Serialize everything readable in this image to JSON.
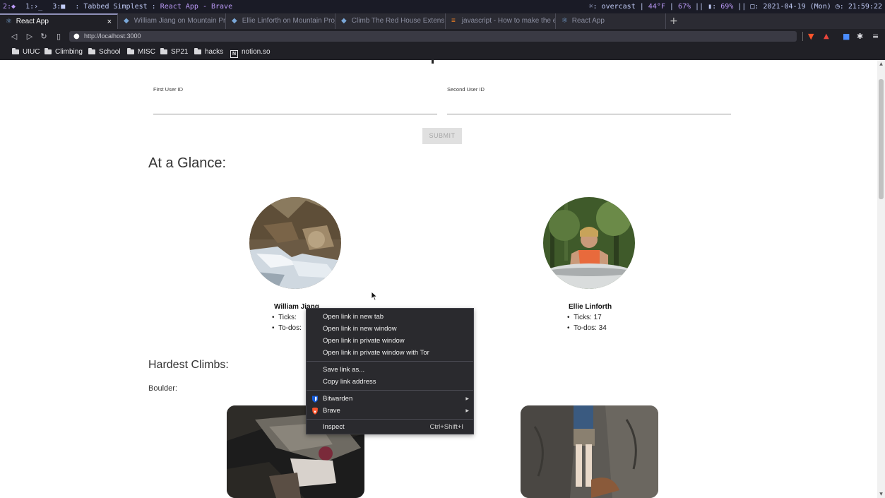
{
  "wm": {
    "ws1": "2:◆",
    "ws2": "1:›_",
    "ws3": "3:■",
    "title_prefix": ": Tabbed Simplest : ",
    "title_app": "React App - Brave",
    "weather": "☼: overcast",
    "temp": "44°F",
    "brightness": "67%",
    "battery_label": "▮:",
    "battery": "69%",
    "date": "□: 2021-04-19 (Mon)",
    "time": "◷: 21:59:22"
  },
  "tabs": [
    {
      "label": "React App",
      "active": true,
      "close": "×"
    },
    {
      "label": "William Jiang on Mountain Proje"
    },
    {
      "label": "Ellie Linforth on Mountain Proje"
    },
    {
      "label": "Climb The Red House Extension"
    },
    {
      "label": "javascript - How to make the en"
    },
    {
      "label": "React App"
    }
  ],
  "newtab": "+",
  "nav": {
    "back": "◁",
    "forward": "▷",
    "reload": "↻",
    "bookmark": "▯",
    "url": "http://localhost:3000"
  },
  "bookmarks": [
    {
      "label": "UIUC"
    },
    {
      "label": "Climbing"
    },
    {
      "label": "School"
    },
    {
      "label": "MISC"
    },
    {
      "label": "SP21"
    },
    {
      "label": "hacks"
    },
    {
      "label": "notion.so"
    }
  ],
  "page": {
    "form": {
      "first_label": "First User ID",
      "second_label": "Second User ID",
      "first_value": "",
      "second_value": "",
      "submit": "SUBMIT"
    },
    "glance_heading": "At a Glance:",
    "users": [
      {
        "name": "William Jiang",
        "ticks": "Ticks:",
        "todos": "To-dos:"
      },
      {
        "name": "Ellie Linforth",
        "ticks": "Ticks: 17",
        "todos": "To-dos: 34"
      }
    ],
    "hardest_heading": "Hardest Climbs:",
    "boulder_label": "Boulder:"
  },
  "context_menu": {
    "open_new_tab": "Open link in new tab",
    "open_new_window": "Open link in new window",
    "open_private": "Open link in private window",
    "open_tor": "Open link in private window with Tor",
    "save_link": "Save link as...",
    "copy_link": "Copy link address",
    "bitwarden": "Bitwarden",
    "brave": "Brave",
    "inspect": "Inspect",
    "inspect_shortcut": "Ctrl+Shift+I"
  },
  "colors": {
    "wm_bg": "#1a1b26",
    "wm_accent": "#bb9af7",
    "tab_bg": "#2b2b33",
    "toolbar_bg": "#202026",
    "menu_bg": "#2a2a2e",
    "brave_orange": "#fb542b",
    "bitwarden_blue": "#175ddc"
  }
}
